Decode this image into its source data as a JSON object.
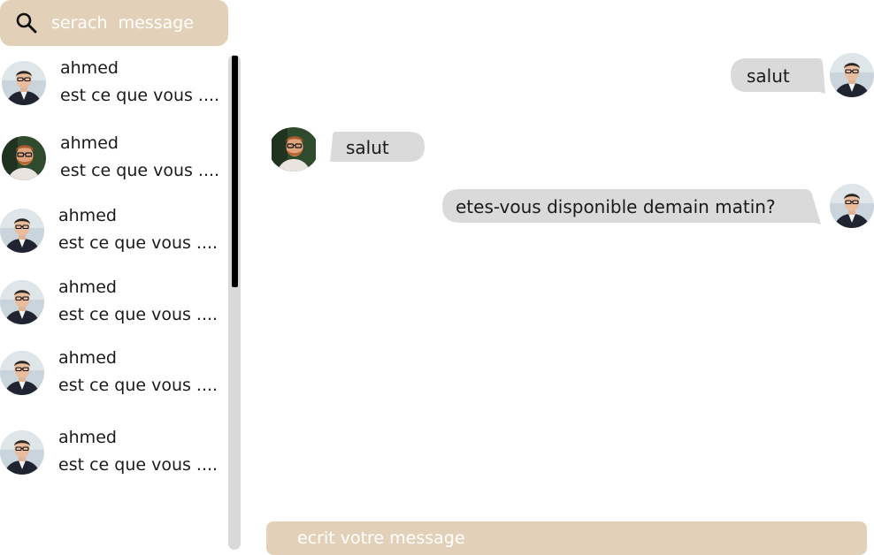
{
  "search": {
    "placeholder": "serach  message",
    "icon": "search-icon"
  },
  "conversations": [
    {
      "name": "ahmed",
      "preview": "est ce que vous ....",
      "avatar": "avatar-man-suit"
    },
    {
      "name": "ahmed",
      "preview": "est ce que vous ....",
      "avatar": "avatar-man-beard"
    },
    {
      "name": "ahmed",
      "preview": "est ce que vous ....",
      "avatar": "avatar-man-suit"
    },
    {
      "name": "ahmed",
      "preview": "est ce que vous ....",
      "avatar": "avatar-man-suit"
    },
    {
      "name": "ahmed",
      "preview": "est ce que vous ....",
      "avatar": "avatar-man-suit"
    },
    {
      "name": "ahmed",
      "preview": "est ce que vous ....",
      "avatar": "avatar-man-suit"
    }
  ],
  "messages": [
    {
      "side": "sent",
      "text": "salut"
    },
    {
      "side": "received",
      "text": "salut"
    },
    {
      "side": "sent",
      "text": "etes-vous disponible demain matin?"
    }
  ],
  "composer": {
    "placeholder": "ecrit votre message"
  },
  "colors": {
    "accent": "#e2d1b8",
    "bubble": "#dadada",
    "scroll_track": "#d9d9d9",
    "scroll_thumb": "#000000"
  }
}
